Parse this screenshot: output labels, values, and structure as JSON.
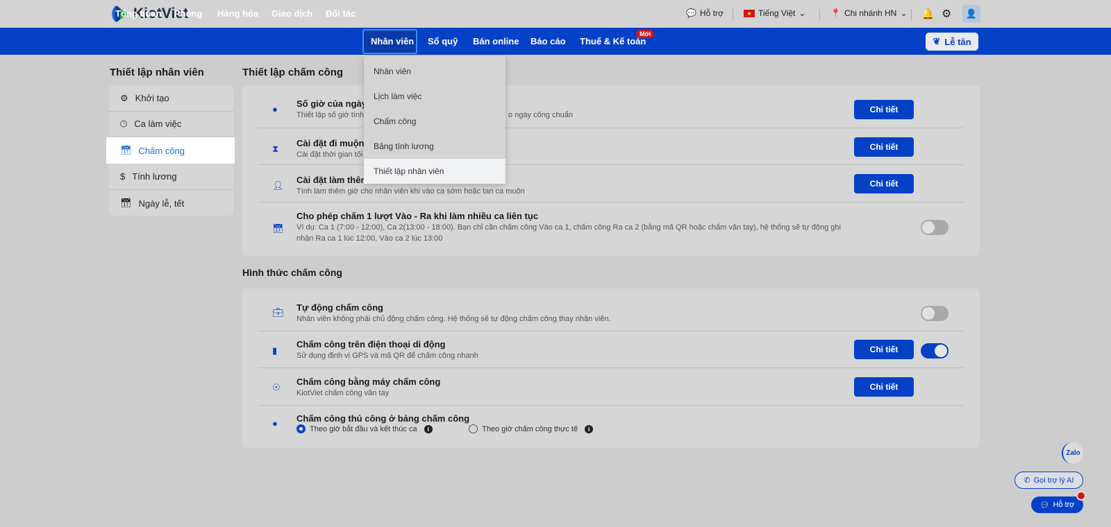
{
  "header": {
    "logo": "KiotViet",
    "support": "Hỗ trợ",
    "language": "Tiếng Việt",
    "branch": "Chi nhánh HN"
  },
  "nav": {
    "items": [
      "Tổng quan",
      "Phòng",
      "Hàng hóa",
      "Giao dịch",
      "Đối tác",
      "Nhân viên",
      "Sổ quỹ",
      "Bán online",
      "Báo cáo",
      "Thuế & Kế toán"
    ],
    "new_badge": "Mới",
    "reception": "Lễ tân"
  },
  "dropdown": [
    "Nhân viên",
    "Lịch làm việc",
    "Chấm công",
    "Bảng tính lương",
    "Thiết lập nhân viên"
  ],
  "sidebar": {
    "title": "Thiết lập nhân viên",
    "items": [
      "Khởi tạo",
      "Ca làm việc",
      "Chấm công",
      "Tính lương",
      "Ngày lễ, tết"
    ]
  },
  "section1": {
    "title": "Thiết lập chấm công",
    "rows": [
      {
        "title": "Số giờ của ngày",
        "desc": "Thiết lập số giờ tính",
        "desc_tail": "o ngày công chuẩn",
        "button": "Chi tiết"
      },
      {
        "title": "Cài đặt đi muộn -",
        "desc": "Cài đặt thời gian tối",
        "button": "Chi tiết"
      },
      {
        "title": "Cài đặt làm thêm",
        "desc": "Tính làm thêm giờ cho nhân viên khi vào ca sớm hoặc tan ca muộn",
        "button": "Chi tiết"
      },
      {
        "title": "Cho phép chấm 1 lượt Vào - Ra khi làm nhiều ca liên tục",
        "desc": "Ví dụ: Ca 1 (7:00 - 12:00), Ca 2(13:00 - 18:00). Bạn chỉ cần chấm công Vào ca 1, chấm công Ra ca 2 (bằng mã QR hoặc chấm vân tay), hệ thống sẽ tự động ghi nhận Ra ca 1 lúc 12:00, Vào ca 2 lúc 13:00",
        "toggle": false
      }
    ]
  },
  "section2": {
    "title": "Hình thức chấm công",
    "rows": [
      {
        "title": "Tự động chấm công",
        "desc": "Nhân viên không phải chủ động chấm công. Hệ thống sẽ tự động chấm công thay nhân viên.",
        "toggle": false
      },
      {
        "title": "Chấm công trên điện thoại di động",
        "desc": "Sử dụng định vị GPS và mã QR để chấm công nhanh",
        "button": "Chi tiết",
        "toggle": true
      },
      {
        "title": "Chấm công bằng máy chấm công",
        "desc": "KiotViet chấm công vân tay",
        "button": "Chi tiết"
      },
      {
        "title": "Chấm công thủ công ở bảng chấm công",
        "options": [
          "Theo giờ bắt đầu và kết thúc ca",
          "Theo giờ chấm công thực tế"
        ],
        "selected": 0
      }
    ]
  },
  "floating": {
    "zalo": "Zalo",
    "ai": "Gọi trợ lý AI",
    "support": "Hỗ trợ"
  },
  "colors": {
    "brand": "#0541c6",
    "badge": "#d3141c"
  }
}
